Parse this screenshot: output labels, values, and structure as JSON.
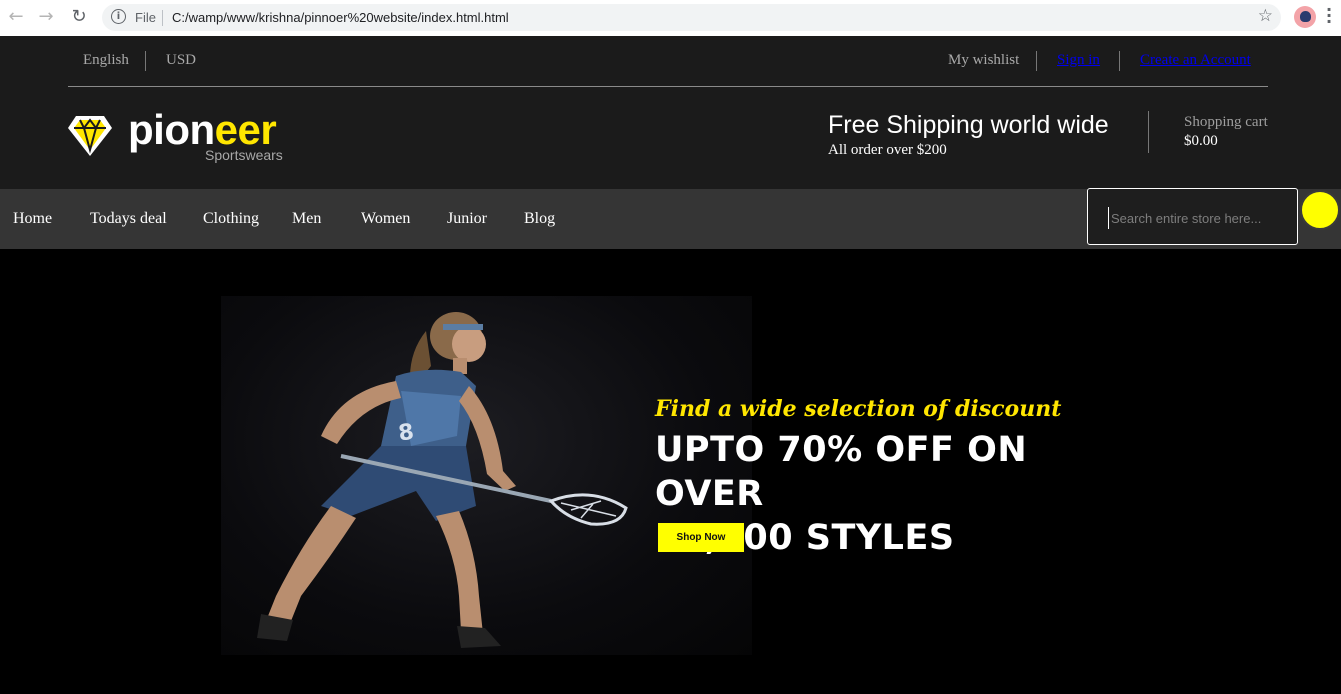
{
  "browser": {
    "back_icon": "arrow-left-icon",
    "forward_icon": "arrow-right-icon",
    "reload_icon": "reload-icon",
    "file_label": "File",
    "url": "C:/wamp/www/krishna/pinnoer%20website/index.html.html",
    "star_icon": "star-icon",
    "menu_icon": "more-vertical-icon"
  },
  "topbar": {
    "language": "English",
    "currency": "USD",
    "wishlist": "My wishlist",
    "sign_in": "Sign in",
    "create_account": "Create an Account"
  },
  "brand": {
    "name_white": "pion",
    "name_yellow": "eer",
    "tagline": "Sportswears",
    "icon": "diamond-icon",
    "accent_color": "#ffe600"
  },
  "shipping": {
    "title": "Free Shipping world wide",
    "subtitle": "All order over $200"
  },
  "cart": {
    "label": "Shopping cart",
    "total": "$0.00"
  },
  "menu": {
    "items": [
      "Home",
      "Todays deal",
      "Clothing",
      "Men",
      "Women",
      "Junior",
      "Blog"
    ]
  },
  "search": {
    "placeholder": "Search entire store here..."
  },
  "hero": {
    "kicker": "Find a wide selection of discount",
    "headline_line1": "UPTO 70% OFF ON OVER",
    "headline_line2": "18,000 STYLES",
    "cta": "Shop Now",
    "image_alt": "lacrosse-player-photo"
  }
}
